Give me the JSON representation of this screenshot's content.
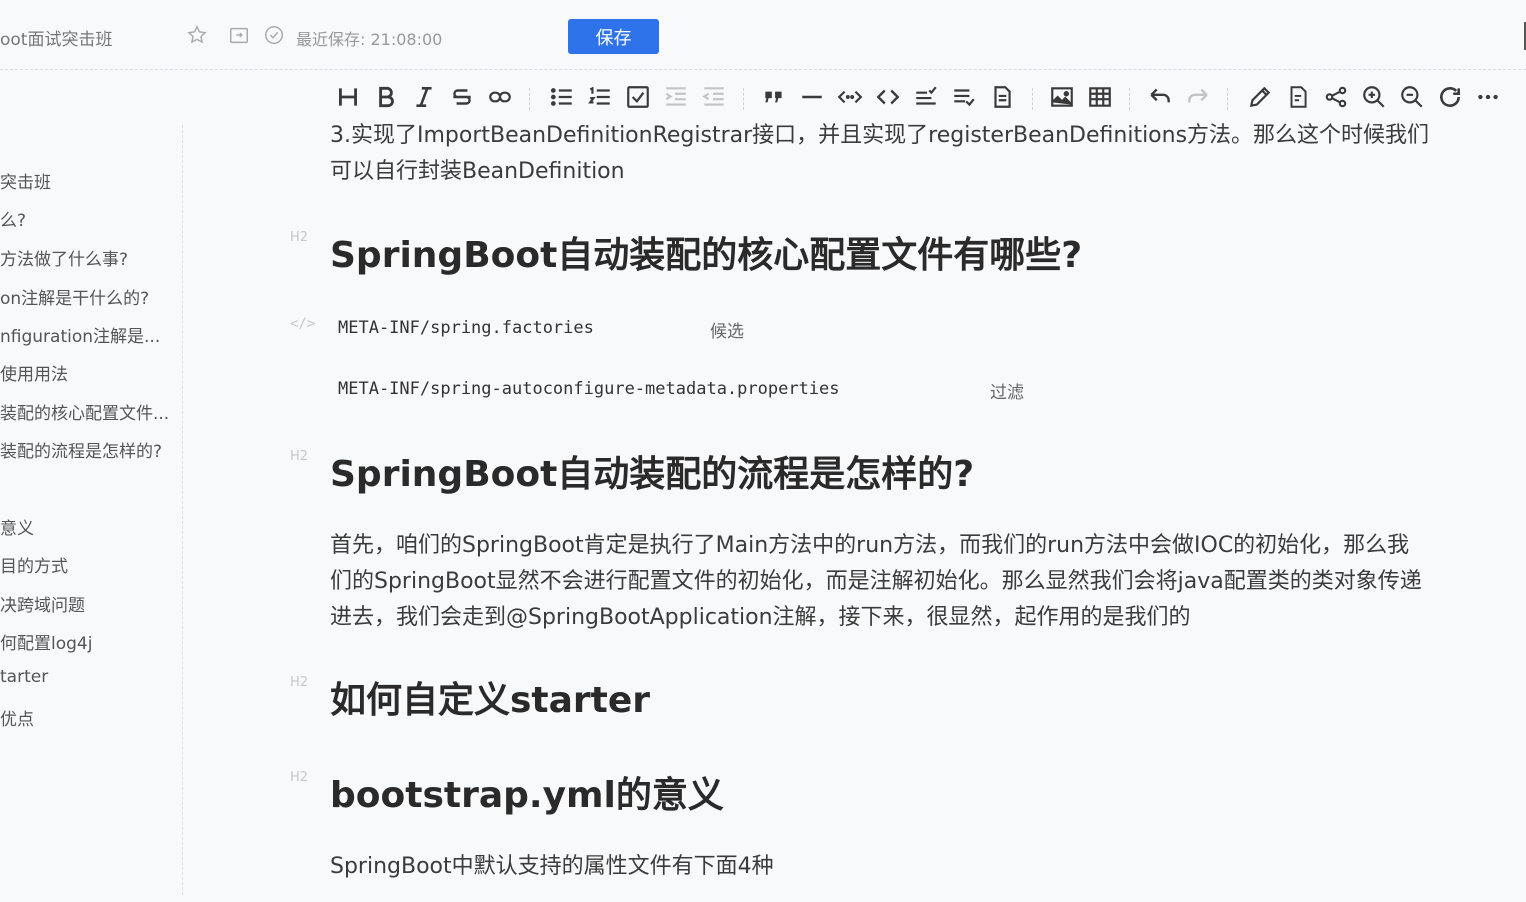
{
  "topbar": {
    "doc_title": "oot面试突击班",
    "save_status": "最近保存: 21:08:00",
    "save_label": "保存"
  },
  "toolbar": {
    "buttons": [
      "heading-icon",
      "bold-icon",
      "italic-icon",
      "strikethrough-icon",
      "link-icon",
      "unordered-list-icon",
      "ordered-list-icon",
      "checklist-icon",
      "indent-icon",
      "outdent-icon",
      "quote-icon",
      "horizontal-rule-icon",
      "inline-code-icon",
      "code-block-icon",
      "check-lines-icon",
      "line-check-icon",
      "table-of-contents-icon",
      "image-icon",
      "table-icon",
      "undo-icon",
      "redo-icon",
      "edit-icon",
      "export-icon",
      "share-icon",
      "zoom-in-icon",
      "zoom-out-icon",
      "refresh-icon",
      "more-icon"
    ]
  },
  "sidebar": {
    "items": [
      "突击班",
      "么?",
      "方法做了什么事?",
      "on注解是干什么的?",
      "nfiguration注解是...",
      "使用用法",
      "装配的核心配置文件...",
      "装配的流程是怎样的?",
      "意义",
      "目的方式",
      "决跨域问题",
      "何配置log4j",
      "tarter",
      "优点"
    ]
  },
  "content": {
    "intro_line1": "3.实现了ImportBeanDefinitionRegistrar接口，并且实现了registerBeanDefinitions方法。那么这个时候我们",
    "intro_line2": "可以自行封装BeanDefinition",
    "h2_marker": "H2",
    "code_marker": "</>",
    "heading1": "SpringBoot自动装配的核心配置文件有哪些?",
    "code1": "META-INF/spring.factories",
    "note1": "候选",
    "code2": "META-INF/spring-autoconfigure-metadata.properties",
    "note2": "过滤",
    "heading2": "SpringBoot自动装配的流程是怎样的?",
    "para_line1": "首先，咱们的SpringBoot肯定是执行了Main方法中的run方法，而我们的run方法中会做IOC的初始化，那么我",
    "para_line2": "们的SpringBoot显然不会进行配置文件的初始化，而是注解初始化。那么显然我们会将java配置类的类对象传递",
    "para_line3": "进去，我们会走到@SpringBootApplication注解，接下来，很显然，起作用的是我们的",
    "heading3": "如何自定义starter",
    "heading4": "bootstrap.yml的意义",
    "last_line": "SpringBoot中默认支持的属性文件有下面4种"
  }
}
